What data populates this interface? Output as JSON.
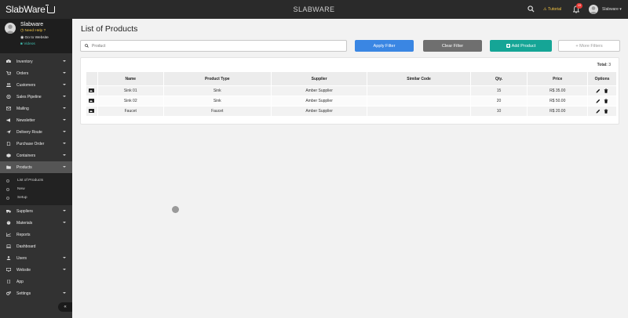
{
  "app": {
    "logo_text": "SlabWare",
    "title": "SLABWARE",
    "tutorial_label": "Tutorial",
    "notification_count": "19",
    "user_name": "Slabware"
  },
  "profile": {
    "name": "Slabware",
    "help_link": "Need Help ?",
    "goto_link": "Go to Website",
    "videos_link": "Videos"
  },
  "sidebar": {
    "items": [
      {
        "label": "Inventory",
        "icon": "boxes-icon"
      },
      {
        "label": "Orders",
        "icon": "cart-icon"
      },
      {
        "label": "Customers",
        "icon": "users-icon"
      },
      {
        "label": "Sales Pipeline",
        "icon": "pipeline-icon"
      },
      {
        "label": "Mailing",
        "icon": "mail-icon"
      },
      {
        "label": "Newsletter",
        "icon": "megaphone-icon"
      },
      {
        "label": "Delivery Route",
        "icon": "send-icon"
      },
      {
        "label": "Purchase Order",
        "icon": "file-icon"
      },
      {
        "label": "Containers",
        "icon": "cube-icon"
      },
      {
        "label": "Products",
        "icon": "folder-icon"
      }
    ],
    "products_sub": [
      "List of Products",
      "New",
      "Setup"
    ],
    "items_after": [
      {
        "label": "Suppliers",
        "icon": "truck-icon"
      },
      {
        "label": "Materials",
        "icon": "palette-icon"
      },
      {
        "label": "Reports",
        "icon": "chart-icon"
      },
      {
        "label": "Dashboard",
        "icon": "laptop-icon"
      },
      {
        "label": "Users",
        "icon": "user-icon"
      },
      {
        "label": "Website",
        "icon": "monitor-icon"
      },
      {
        "label": "App",
        "icon": "mobile-icon"
      },
      {
        "label": "Settings",
        "icon": "gears-icon"
      }
    ],
    "collapse_label": "«"
  },
  "main": {
    "page_title": "List of Products",
    "search_placeholder": "Product",
    "apply_filter": "Apply Filter",
    "clear_filter": "Clear Filter",
    "add_product": "Add Product",
    "more_filters": "+ More Filters",
    "total_label": "Total:",
    "total_value": "3",
    "columns": [
      "",
      "Name",
      "Product Type",
      "Supplier",
      "Similar Code",
      "Qty.",
      "Price",
      "Options"
    ],
    "rows": [
      {
        "name": "Sink 01",
        "type": "Sink",
        "supplier": "Amber Supplier",
        "similar_code": "",
        "qty": "15",
        "price": "R$ 35.00"
      },
      {
        "name": "Sink 02",
        "type": "Sink",
        "supplier": "Amber Supplier",
        "similar_code": "",
        "qty": "20",
        "price": "R$ 50.00"
      },
      {
        "name": "Faucet",
        "type": "Faucet",
        "supplier": "Amber Supplier",
        "similar_code": "",
        "qty": "10",
        "price": "R$ 20.00"
      }
    ]
  },
  "colors": {
    "apply": "#3a86e3",
    "clear": "#6f6f6f",
    "add": "#15a596",
    "topbar": "#2a2a2a",
    "sidebar": "#323232"
  }
}
